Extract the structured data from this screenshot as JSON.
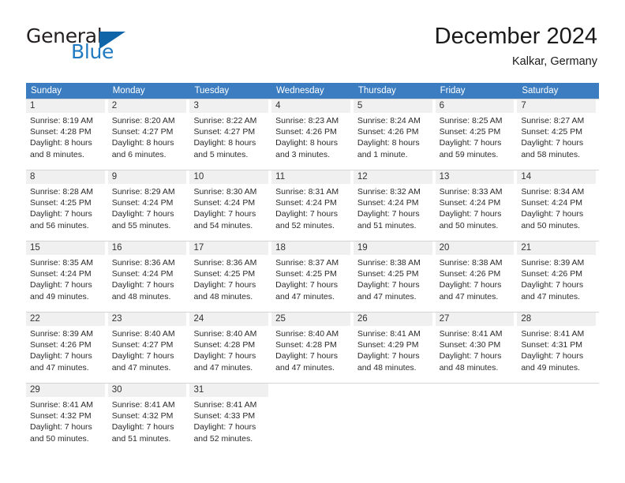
{
  "brand": {
    "name_part1": "General",
    "name_part2": "Blue",
    "color_dark": "#231f20",
    "color_blue": "#1f7ac2",
    "triangle_color": "#1065a8"
  },
  "header": {
    "title": "December 2024",
    "location": "Kalkar, Germany"
  },
  "theme": {
    "header_row_bg": "#3b7dc0",
    "day_number_bg": "#f0f0f0",
    "grid_line": "#d4d4d4"
  },
  "weekdays": [
    "Sunday",
    "Monday",
    "Tuesday",
    "Wednesday",
    "Thursday",
    "Friday",
    "Saturday"
  ],
  "weeks": [
    [
      {
        "day": "1",
        "sunrise": "Sunrise: 8:19 AM",
        "sunset": "Sunset: 4:28 PM",
        "daylight_line1": "Daylight: 8 hours",
        "daylight_line2": "and 8 minutes."
      },
      {
        "day": "2",
        "sunrise": "Sunrise: 8:20 AM",
        "sunset": "Sunset: 4:27 PM",
        "daylight_line1": "Daylight: 8 hours",
        "daylight_line2": "and 6 minutes."
      },
      {
        "day": "3",
        "sunrise": "Sunrise: 8:22 AM",
        "sunset": "Sunset: 4:27 PM",
        "daylight_line1": "Daylight: 8 hours",
        "daylight_line2": "and 5 minutes."
      },
      {
        "day": "4",
        "sunrise": "Sunrise: 8:23 AM",
        "sunset": "Sunset: 4:26 PM",
        "daylight_line1": "Daylight: 8 hours",
        "daylight_line2": "and 3 minutes."
      },
      {
        "day": "5",
        "sunrise": "Sunrise: 8:24 AM",
        "sunset": "Sunset: 4:26 PM",
        "daylight_line1": "Daylight: 8 hours",
        "daylight_line2": "and 1 minute."
      },
      {
        "day": "6",
        "sunrise": "Sunrise: 8:25 AM",
        "sunset": "Sunset: 4:25 PM",
        "daylight_line1": "Daylight: 7 hours",
        "daylight_line2": "and 59 minutes."
      },
      {
        "day": "7",
        "sunrise": "Sunrise: 8:27 AM",
        "sunset": "Sunset: 4:25 PM",
        "daylight_line1": "Daylight: 7 hours",
        "daylight_line2": "and 58 minutes."
      }
    ],
    [
      {
        "day": "8",
        "sunrise": "Sunrise: 8:28 AM",
        "sunset": "Sunset: 4:25 PM",
        "daylight_line1": "Daylight: 7 hours",
        "daylight_line2": "and 56 minutes."
      },
      {
        "day": "9",
        "sunrise": "Sunrise: 8:29 AM",
        "sunset": "Sunset: 4:24 PM",
        "daylight_line1": "Daylight: 7 hours",
        "daylight_line2": "and 55 minutes."
      },
      {
        "day": "10",
        "sunrise": "Sunrise: 8:30 AM",
        "sunset": "Sunset: 4:24 PM",
        "daylight_line1": "Daylight: 7 hours",
        "daylight_line2": "and 54 minutes."
      },
      {
        "day": "11",
        "sunrise": "Sunrise: 8:31 AM",
        "sunset": "Sunset: 4:24 PM",
        "daylight_line1": "Daylight: 7 hours",
        "daylight_line2": "and 52 minutes."
      },
      {
        "day": "12",
        "sunrise": "Sunrise: 8:32 AM",
        "sunset": "Sunset: 4:24 PM",
        "daylight_line1": "Daylight: 7 hours",
        "daylight_line2": "and 51 minutes."
      },
      {
        "day": "13",
        "sunrise": "Sunrise: 8:33 AM",
        "sunset": "Sunset: 4:24 PM",
        "daylight_line1": "Daylight: 7 hours",
        "daylight_line2": "and 50 minutes."
      },
      {
        "day": "14",
        "sunrise": "Sunrise: 8:34 AM",
        "sunset": "Sunset: 4:24 PM",
        "daylight_line1": "Daylight: 7 hours",
        "daylight_line2": "and 50 minutes."
      }
    ],
    [
      {
        "day": "15",
        "sunrise": "Sunrise: 8:35 AM",
        "sunset": "Sunset: 4:24 PM",
        "daylight_line1": "Daylight: 7 hours",
        "daylight_line2": "and 49 minutes."
      },
      {
        "day": "16",
        "sunrise": "Sunrise: 8:36 AM",
        "sunset": "Sunset: 4:24 PM",
        "daylight_line1": "Daylight: 7 hours",
        "daylight_line2": "and 48 minutes."
      },
      {
        "day": "17",
        "sunrise": "Sunrise: 8:36 AM",
        "sunset": "Sunset: 4:25 PM",
        "daylight_line1": "Daylight: 7 hours",
        "daylight_line2": "and 48 minutes."
      },
      {
        "day": "18",
        "sunrise": "Sunrise: 8:37 AM",
        "sunset": "Sunset: 4:25 PM",
        "daylight_line1": "Daylight: 7 hours",
        "daylight_line2": "and 47 minutes."
      },
      {
        "day": "19",
        "sunrise": "Sunrise: 8:38 AM",
        "sunset": "Sunset: 4:25 PM",
        "daylight_line1": "Daylight: 7 hours",
        "daylight_line2": "and 47 minutes."
      },
      {
        "day": "20",
        "sunrise": "Sunrise: 8:38 AM",
        "sunset": "Sunset: 4:26 PM",
        "daylight_line1": "Daylight: 7 hours",
        "daylight_line2": "and 47 minutes."
      },
      {
        "day": "21",
        "sunrise": "Sunrise: 8:39 AM",
        "sunset": "Sunset: 4:26 PM",
        "daylight_line1": "Daylight: 7 hours",
        "daylight_line2": "and 47 minutes."
      }
    ],
    [
      {
        "day": "22",
        "sunrise": "Sunrise: 8:39 AM",
        "sunset": "Sunset: 4:26 PM",
        "daylight_line1": "Daylight: 7 hours",
        "daylight_line2": "and 47 minutes."
      },
      {
        "day": "23",
        "sunrise": "Sunrise: 8:40 AM",
        "sunset": "Sunset: 4:27 PM",
        "daylight_line1": "Daylight: 7 hours",
        "daylight_line2": "and 47 minutes."
      },
      {
        "day": "24",
        "sunrise": "Sunrise: 8:40 AM",
        "sunset": "Sunset: 4:28 PM",
        "daylight_line1": "Daylight: 7 hours",
        "daylight_line2": "and 47 minutes."
      },
      {
        "day": "25",
        "sunrise": "Sunrise: 8:40 AM",
        "sunset": "Sunset: 4:28 PM",
        "daylight_line1": "Daylight: 7 hours",
        "daylight_line2": "and 47 minutes."
      },
      {
        "day": "26",
        "sunrise": "Sunrise: 8:41 AM",
        "sunset": "Sunset: 4:29 PM",
        "daylight_line1": "Daylight: 7 hours",
        "daylight_line2": "and 48 minutes."
      },
      {
        "day": "27",
        "sunrise": "Sunrise: 8:41 AM",
        "sunset": "Sunset: 4:30 PM",
        "daylight_line1": "Daylight: 7 hours",
        "daylight_line2": "and 48 minutes."
      },
      {
        "day": "28",
        "sunrise": "Sunrise: 8:41 AM",
        "sunset": "Sunset: 4:31 PM",
        "daylight_line1": "Daylight: 7 hours",
        "daylight_line2": "and 49 minutes."
      }
    ],
    [
      {
        "day": "29",
        "sunrise": "Sunrise: 8:41 AM",
        "sunset": "Sunset: 4:32 PM",
        "daylight_line1": "Daylight: 7 hours",
        "daylight_line2": "and 50 minutes."
      },
      {
        "day": "30",
        "sunrise": "Sunrise: 8:41 AM",
        "sunset": "Sunset: 4:32 PM",
        "daylight_line1": "Daylight: 7 hours",
        "daylight_line2": "and 51 minutes."
      },
      {
        "day": "31",
        "sunrise": "Sunrise: 8:41 AM",
        "sunset": "Sunset: 4:33 PM",
        "daylight_line1": "Daylight: 7 hours",
        "daylight_line2": "and 52 minutes."
      },
      {
        "day": "",
        "sunrise": "",
        "sunset": "",
        "daylight_line1": "",
        "daylight_line2": ""
      },
      {
        "day": "",
        "sunrise": "",
        "sunset": "",
        "daylight_line1": "",
        "daylight_line2": ""
      },
      {
        "day": "",
        "sunrise": "",
        "sunset": "",
        "daylight_line1": "",
        "daylight_line2": ""
      },
      {
        "day": "",
        "sunrise": "",
        "sunset": "",
        "daylight_line1": "",
        "daylight_line2": ""
      }
    ]
  ]
}
